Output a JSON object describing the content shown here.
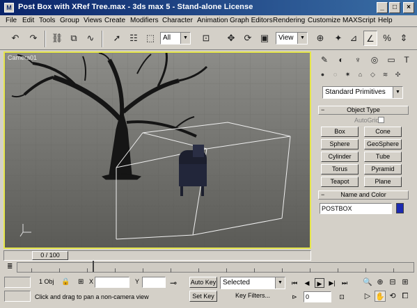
{
  "window": {
    "title": "Post Box with XRef Tree.max - 3ds max 5 - Stand-alone License",
    "app_icon": "3ds-max-icon",
    "min": "_",
    "max": "□",
    "close": "×"
  },
  "menu": [
    "File",
    "Edit",
    "Tools",
    "Group",
    "Views",
    "Create",
    "Modifiers",
    "Character",
    "Animation",
    "Graph Editors",
    "Rendering",
    "Customize",
    "MAXScript",
    "Help"
  ],
  "toolbar": {
    "selection_filter": "All",
    "ref_coord": "View"
  },
  "viewport": {
    "label": "Camera01",
    "border_color": "#e6e64a",
    "ground_color": "#6e6e6a",
    "objects": [
      "tree",
      "mailbox"
    ]
  },
  "command_panel": {
    "category_dropdown": "Standard Primitives",
    "object_type_title": "Object Type",
    "autogrid_label": "AutoGrid",
    "buttons": [
      "Box",
      "Cone",
      "Sphere",
      "GeoSphere",
      "Cylinder",
      "Tube",
      "Torus",
      "Pyramid",
      "Teapot",
      "Plane"
    ],
    "name_color_title": "Name and Color",
    "object_name": "POSTBOX",
    "object_color": "#1c2ab0"
  },
  "timeline": {
    "slider_label": "0 / 100"
  },
  "status": {
    "selection_count": "1 Obj",
    "x_label": "X",
    "y_label": "Y",
    "x_value": "",
    "y_value": "",
    "prompt": "Click and drag to pan a non-camera view",
    "auto_key": "Auto Key",
    "set_key": "Set Key",
    "selected_dropdown": "Selected",
    "key_filters": "Key Filters...",
    "frame_value": "0"
  }
}
